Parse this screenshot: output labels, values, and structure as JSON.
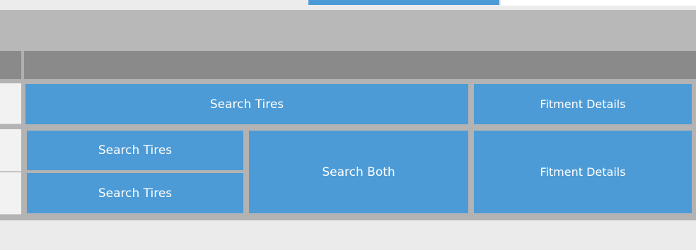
{
  "grid": {
    "row1": {
      "search_tires": "Search Tires",
      "fitment_details": "Fitment Details"
    },
    "row2": {
      "search_tires_top": "Search Tires",
      "search_tires_bottom": "Search Tires",
      "search_both": "Search Both",
      "fitment_details": "Fitment Details"
    }
  },
  "colors": {
    "accent": "#4c9bd6",
    "header": "#8a8a8a",
    "toolbar": "#b8b8b8",
    "background": "#ebebeb"
  }
}
